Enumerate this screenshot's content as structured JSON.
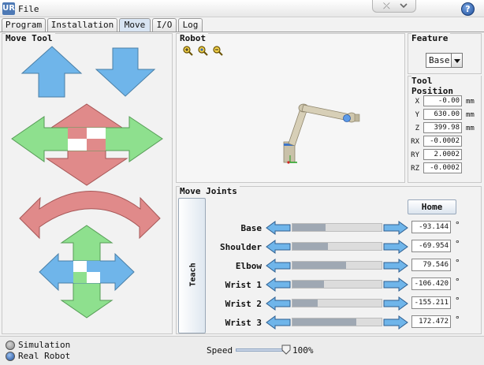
{
  "topbar": {
    "logo_text": "UR",
    "file_label": "File",
    "help_label": "?"
  },
  "tabs": [
    {
      "label": "Program"
    },
    {
      "label": "Installation"
    },
    {
      "label": "Move"
    },
    {
      "label": "I/O"
    },
    {
      "label": "Log"
    }
  ],
  "active_tab": "Move",
  "move_tool": {
    "title": "Move Tool"
  },
  "robot": {
    "title": "Robot"
  },
  "feature": {
    "title": "Feature",
    "selected": "Base"
  },
  "tool_position": {
    "title": "Tool Position",
    "rows": [
      {
        "label": "X",
        "value": "-0.00",
        "unit": "mm"
      },
      {
        "label": "Y",
        "value": "630.00",
        "unit": "mm"
      },
      {
        "label": "Z",
        "value": "399.98",
        "unit": "mm"
      },
      {
        "label": "RX",
        "value": "-0.0002",
        "unit": ""
      },
      {
        "label": "RY",
        "value": "2.0002",
        "unit": ""
      },
      {
        "label": "RZ",
        "value": "-0.0002",
        "unit": ""
      }
    ]
  },
  "move_joints": {
    "title": "Move Joints",
    "teach_label": "Teach",
    "home_label": "Home",
    "joints": [
      {
        "name": "Base",
        "value": "-93.144",
        "unit": "°",
        "level": 0.37
      },
      {
        "name": "Shoulder",
        "value": "-69.954",
        "unit": "°",
        "level": 0.4
      },
      {
        "name": "Elbow",
        "value": "79.546",
        "unit": "°",
        "level": 0.6
      },
      {
        "name": "Wrist 1",
        "value": "-106.420",
        "unit": "°",
        "level": 0.35
      },
      {
        "name": "Wrist 2",
        "value": "-155.211",
        "unit": "°",
        "level": 0.28
      },
      {
        "name": "Wrist 3",
        "value": "172.472",
        "unit": "°",
        "level": 0.72
      }
    ]
  },
  "bottom": {
    "simulation_label": "Simulation",
    "real_robot_label": "Real Robot",
    "speed_label": "Speed",
    "speed_value": "100%"
  },
  "colors": {
    "arrow_blue": "#6fb5ea",
    "arrow_green": "#8ee08e",
    "arrow_red": "#e08a8a",
    "accent": "#1f4f9c"
  }
}
